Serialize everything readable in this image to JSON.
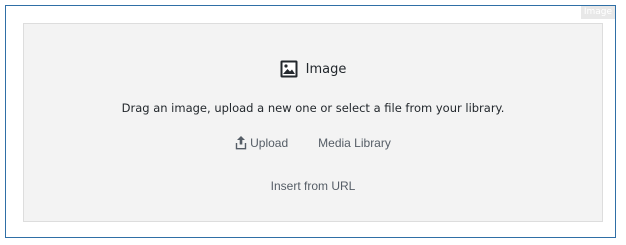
{
  "block": {
    "tag": "Image",
    "label": "Image",
    "label_icon": "image-icon",
    "instructions": "Drag an image, upload a new one or select a file from your library.",
    "actions": {
      "upload_label": "Upload",
      "upload_icon": "upload-icon",
      "media_library_label": "Media Library",
      "insert_url_label": "Insert from URL"
    }
  },
  "colors": {
    "border_accent": "#2f6fa6",
    "placeholder_bg": "#f3f3f3",
    "text": "#23282d",
    "muted_text": "#555d66"
  }
}
